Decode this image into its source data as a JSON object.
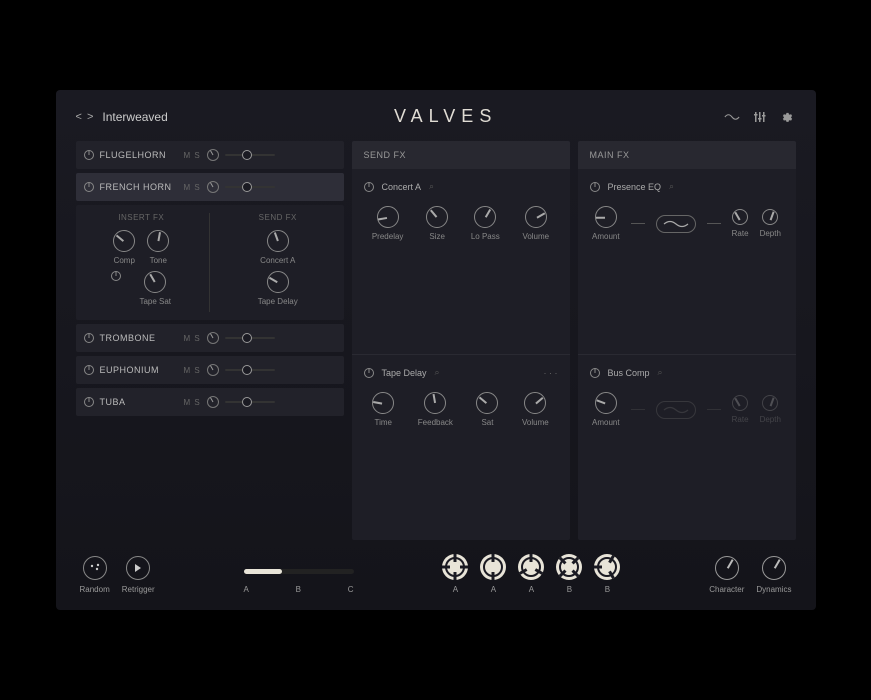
{
  "preset_name": "Interweaved",
  "logo": "VALVES",
  "instruments": [
    {
      "name": "FLUGELHORN",
      "ms": "M S"
    },
    {
      "name": "FRENCH HORN",
      "ms": "M S"
    },
    {
      "name": "TROMBONE",
      "ms": "M S"
    },
    {
      "name": "EUPHONIUM",
      "ms": "M S"
    },
    {
      "name": "TUBA",
      "ms": "M S"
    }
  ],
  "insert_fx": {
    "title": "INSERT FX",
    "knobs": [
      {
        "label": "Comp"
      },
      {
        "label": "Tone"
      },
      {
        "label": "Tape Sat"
      }
    ]
  },
  "inst_send_fx": {
    "title": "SEND FX",
    "knobs": [
      {
        "label": "Concert A"
      },
      {
        "label": "Tape Delay"
      }
    ]
  },
  "send_fx": {
    "title": "SEND FX",
    "blocks": [
      {
        "name": "Concert A",
        "knobs": [
          {
            "label": "Predelay"
          },
          {
            "label": "Size"
          },
          {
            "label": "Lo Pass"
          },
          {
            "label": "Volume"
          }
        ]
      },
      {
        "name": "Tape Delay",
        "knobs": [
          {
            "label": "Time"
          },
          {
            "label": "Feedback"
          },
          {
            "label": "Sat"
          },
          {
            "label": "Volume"
          }
        ]
      }
    ]
  },
  "main_fx": {
    "title": "MAIN FX",
    "blocks": [
      {
        "name": "Presence EQ",
        "knobs": [
          {
            "label": "Amount"
          },
          {
            "label": "Rate"
          },
          {
            "label": "Depth"
          }
        ]
      },
      {
        "name": "Bus Comp",
        "knobs": [
          {
            "label": "Amount"
          },
          {
            "label": "Rate"
          },
          {
            "label": "Depth"
          }
        ]
      }
    ]
  },
  "footer": {
    "random": "Random",
    "retrigger": "Retrigger",
    "abc": [
      "A",
      "B",
      "C"
    ],
    "perf": [
      "A",
      "A",
      "A",
      "B",
      "B"
    ],
    "character": "Character",
    "dynamics": "Dynamics"
  }
}
